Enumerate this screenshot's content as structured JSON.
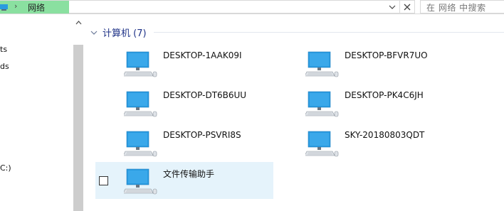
{
  "address_bar": {
    "separator": "›",
    "location": "网络",
    "dropdown_icon": "chevron-down-icon",
    "close_icon": "close-icon"
  },
  "search": {
    "placeholder": "在 网络 中搜索"
  },
  "nav_pane": {
    "items": [
      {
        "label": "ts"
      },
      {
        "label": "ds"
      },
      {
        "label": "C:)"
      }
    ]
  },
  "main": {
    "group": {
      "title": "计算机 (7)"
    },
    "computers": [
      {
        "name": "DESKTOP-1AAK09I"
      },
      {
        "name": "DESKTOP-BFVR7UO"
      },
      {
        "name": "DESKTOP-DT6B6UU"
      },
      {
        "name": "DESKTOP-PK4C6JH"
      },
      {
        "name": "DESKTOP-PSVRI8S"
      },
      {
        "name": "SKY-20180803QDT"
      },
      {
        "name": "文件传输助手",
        "selected": true
      }
    ]
  },
  "colors": {
    "address_highlight": "#8ae0a0",
    "selection": "#e5f3fb",
    "group_title": "#1e3287",
    "monitor_blue": "#2a9be0"
  }
}
